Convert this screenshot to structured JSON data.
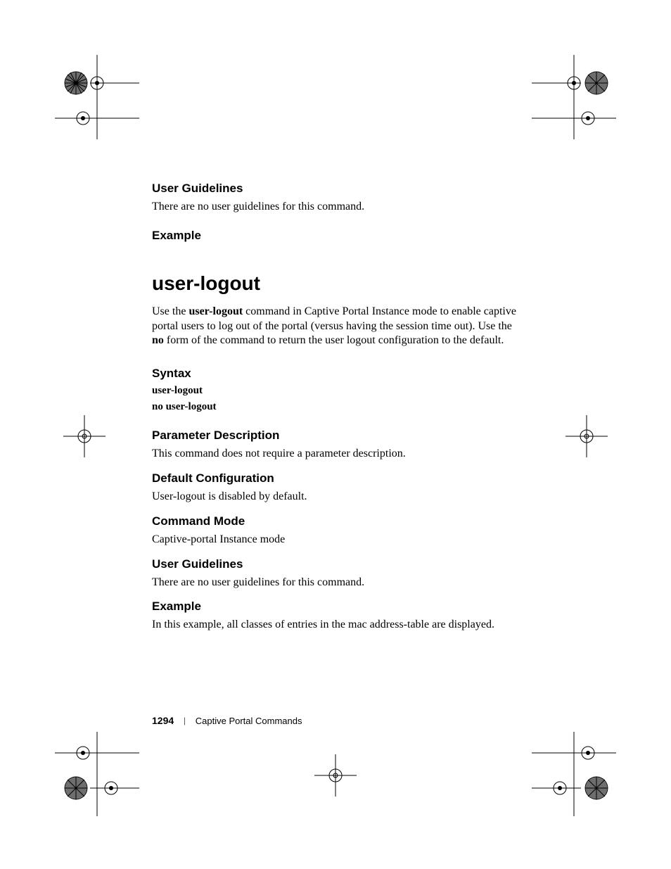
{
  "sections": {
    "user_guidelines_top": {
      "heading": "User Guidelines",
      "body": "There are no user guidelines for this command."
    },
    "example_top": {
      "heading": "Example"
    },
    "command": {
      "title": "user-logout",
      "intro_pre": "Use the ",
      "intro_bold1": "user-logout",
      "intro_mid1": " command in Captive Portal Instance mode to enable captive portal users to log out of the portal (versus having the session time out). Use the ",
      "intro_bold2": "no",
      "intro_post": " form of the command to return the user logout configuration to the default."
    },
    "syntax": {
      "heading": "Syntax",
      "line1": "user-logout",
      "line2": "no user-logout"
    },
    "param": {
      "heading": "Parameter Description",
      "body": "This command does not require a parameter description."
    },
    "default": {
      "heading": "Default Configuration",
      "body": "User-logout is disabled by default."
    },
    "mode": {
      "heading": "Command Mode",
      "body": "Captive-portal Instance mode"
    },
    "user_guidelines_bottom": {
      "heading": "User Guidelines",
      "body": "There are no user guidelines for this command."
    },
    "example_bottom": {
      "heading": "Example",
      "body": "In this example, all classes of entries in the mac address-table are displayed."
    }
  },
  "footer": {
    "page_number": "1294",
    "separator": "|",
    "section_title": "Captive Portal Commands"
  }
}
